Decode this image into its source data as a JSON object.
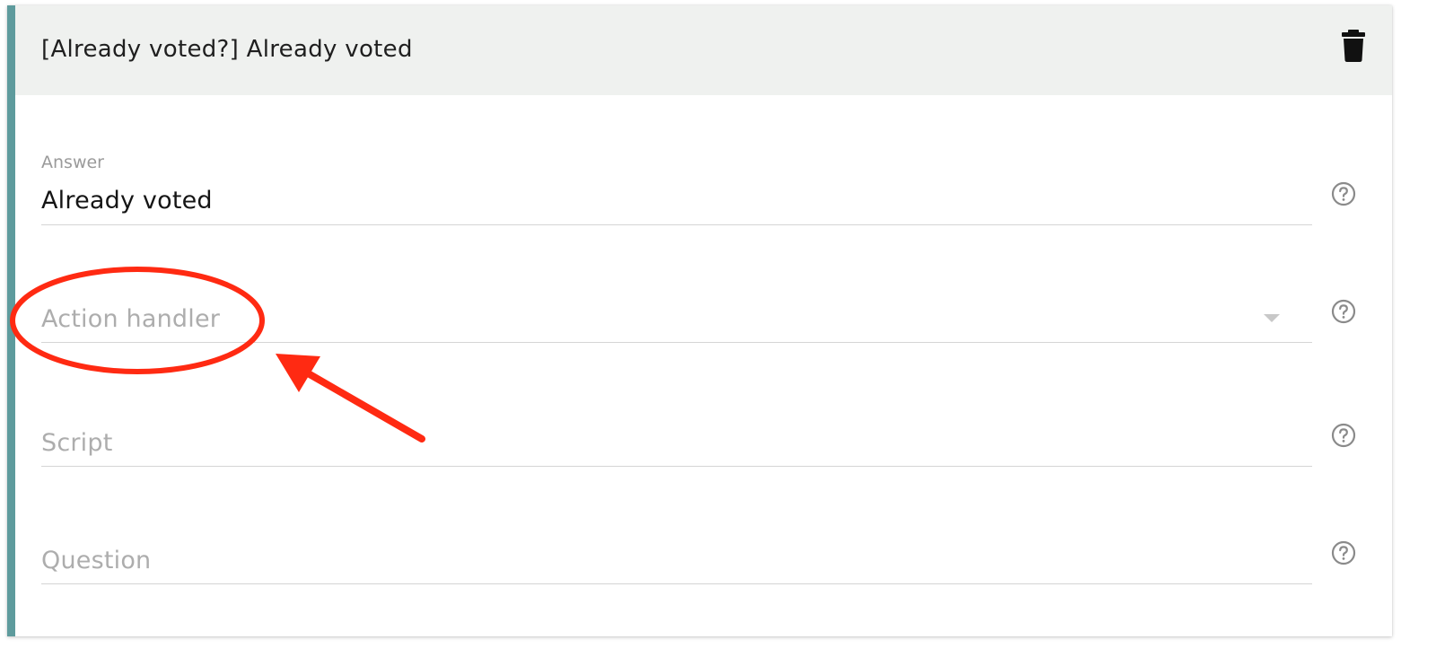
{
  "card": {
    "title": "[Already voted?] Already voted",
    "accent_color": "#5e9b9d",
    "delete_icon": "trash-icon"
  },
  "fields": {
    "answer": {
      "label": "Answer",
      "value": "Already voted",
      "help_icon": "help-circle-icon"
    },
    "action_handler": {
      "placeholder": "Action handler",
      "control": "dropdown",
      "help_icon": "help-circle-icon"
    },
    "script": {
      "placeholder": "Script",
      "help_icon": "help-circle-icon"
    },
    "question": {
      "placeholder": "Question",
      "help_icon": "help-circle-icon"
    }
  },
  "annotation": {
    "color": "#ff2a12",
    "shapes": [
      "ellipse",
      "arrow"
    ]
  }
}
